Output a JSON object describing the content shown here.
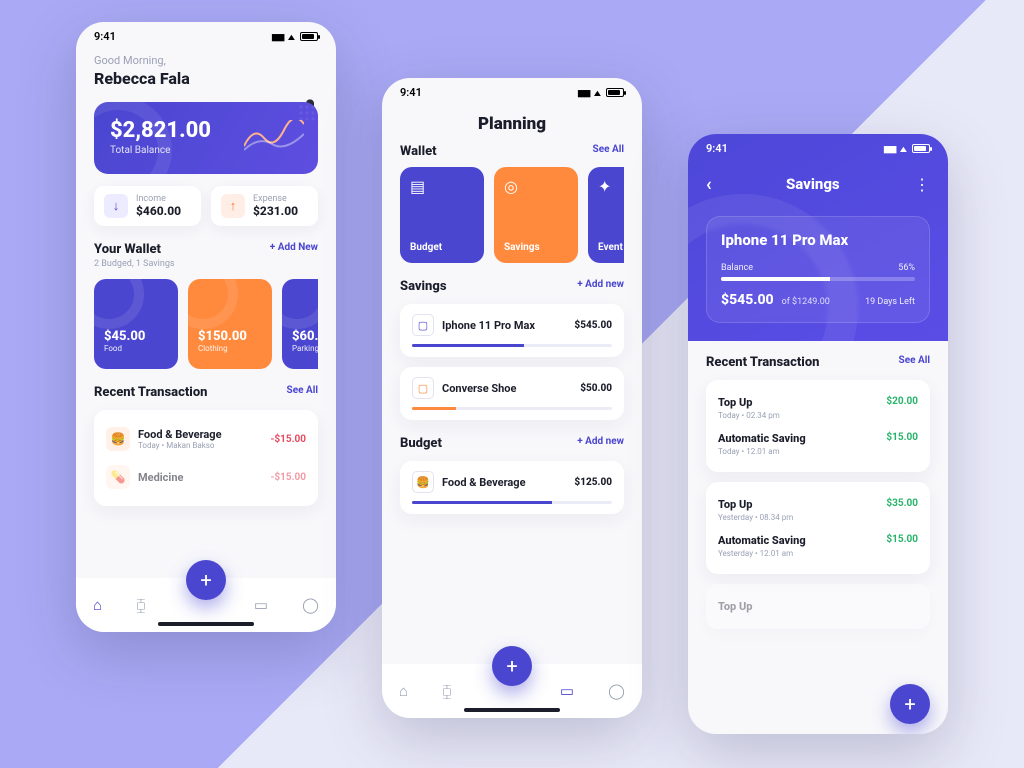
{
  "status_time": "9:41",
  "phone1": {
    "greeting": "Good Morning,",
    "user": "Rebecca Fala",
    "balance": {
      "amount": "$2,821.00",
      "label": "Total Balance"
    },
    "income": {
      "label": "Income",
      "value": "$460.00"
    },
    "expense": {
      "label": "Expense",
      "value": "$231.00"
    },
    "wallet_title": "Your Wallet",
    "wallet_sub": "2 Budged, 1 Savings",
    "add_new": "+  Add New",
    "wallets": [
      {
        "amount": "$45.00",
        "label": "Food",
        "color": "purple"
      },
      {
        "amount": "$150.00",
        "label": "Clothing",
        "color": "orange"
      },
      {
        "amount": "$60.",
        "label": "Parking",
        "color": "purple"
      }
    ],
    "recent_title": "Recent Transaction",
    "see_all": "See All",
    "tx": [
      {
        "name": "Food & Beverage",
        "sub": "Today  •  Makan Bakso",
        "amount": "-$15.00"
      },
      {
        "name": "Medicine",
        "sub": "",
        "amount": "-$15.00"
      }
    ]
  },
  "phone2": {
    "title": "Planning",
    "wallet_title": "Wallet",
    "see_all": "See All",
    "wallets": [
      {
        "label": "Budget",
        "color": "purple"
      },
      {
        "label": "Savings",
        "color": "orange"
      },
      {
        "label": "Event",
        "color": "purple"
      }
    ],
    "savings_title": "Savings",
    "add_new": "+  Add new",
    "savings": [
      {
        "name": "Iphone 11 Pro Max",
        "amount": "$545.00",
        "progress": 56,
        "icon": "purple"
      },
      {
        "name": "Converse Shoe",
        "amount": "$50.00",
        "progress": 22,
        "icon": "orange"
      }
    ],
    "budget_title": "Budget",
    "budgets": [
      {
        "name": "Food & Beverage",
        "amount": "$125.00",
        "progress": 70
      }
    ]
  },
  "phone3": {
    "title": "Savings",
    "item_name": "Iphone 11 Pro Max",
    "balance_label": "Balance",
    "percent": "56%",
    "progress": 56,
    "balance": "$545.00",
    "of_label": "of $1249.00",
    "days_left": "19 Days Left",
    "recent_title": "Recent Transaction",
    "see_all": "See All",
    "groups": [
      {
        "items": [
          {
            "name": "Top Up",
            "sub": "Today  •  02.34 pm",
            "amount": "$20.00"
          },
          {
            "name": "Automatic Saving",
            "sub": "Today  •  12.01 am",
            "amount": "$15.00"
          }
        ]
      },
      {
        "items": [
          {
            "name": "Top Up",
            "sub": "Yesterday  •  08.34 pm",
            "amount": "$35.00"
          },
          {
            "name": "Automatic Saving",
            "sub": "Yesterday  •  12.01 am",
            "amount": "$15.00"
          }
        ]
      },
      {
        "items": [
          {
            "name": "Top Up",
            "sub": "",
            "amount": ""
          }
        ]
      }
    ]
  }
}
